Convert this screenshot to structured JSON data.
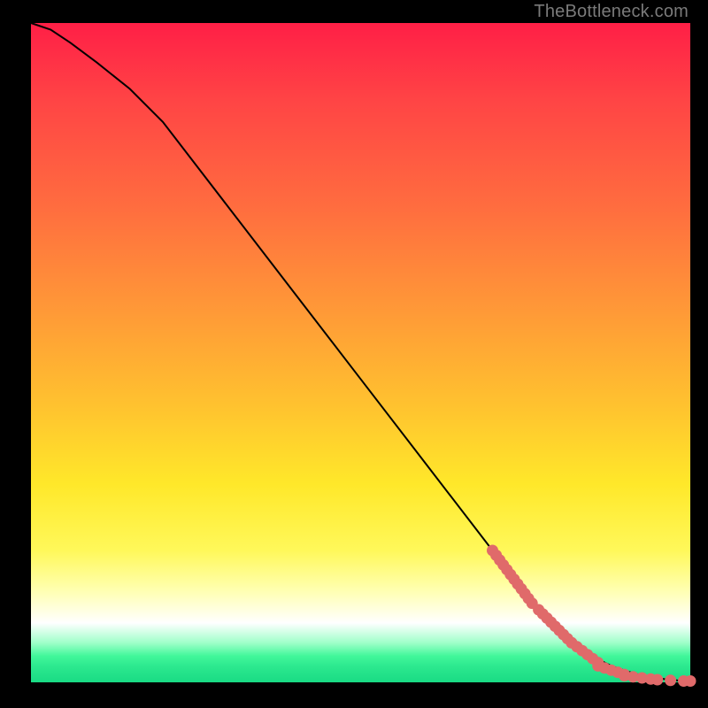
{
  "attribution": "TheBottleneck.com",
  "chart_data": {
    "type": "line",
    "title": "",
    "xlabel": "",
    "ylabel": "",
    "xlim": [
      0,
      100
    ],
    "ylim": [
      0,
      100
    ],
    "series": [
      {
        "name": "curve",
        "x": [
          0,
          3,
          6,
          10,
          15,
          20,
          30,
          40,
          50,
          60,
          70,
          78,
          82,
          85,
          88,
          90,
          92,
          94,
          96,
          98,
          100
        ],
        "y": [
          100,
          99,
          97,
          94,
          90,
          85,
          72,
          59,
          46,
          33,
          20,
          10,
          6,
          4,
          2.5,
          1.8,
          1.2,
          0.8,
          0.5,
          0.3,
          0.2
        ]
      }
    ],
    "markers": [
      {
        "x_range": [
          70,
          76
        ],
        "count": 12,
        "y_from": 20,
        "y_to": 12
      },
      {
        "x_range": [
          77,
          82
        ],
        "count": 9,
        "y_from": 11,
        "y_to": 6
      },
      {
        "x_range": [
          82,
          86
        ],
        "count": 6,
        "y_from": 6,
        "y_to": 3
      },
      {
        "x_range": [
          86,
          90
        ],
        "count": 5,
        "y_from": 2.5,
        "y_to": 1.2
      },
      {
        "x_range": [
          90,
          94
        ],
        "count": 4,
        "y_from": 1.0,
        "y_to": 0.5
      },
      {
        "x_range": [
          95,
          97
        ],
        "count": 2,
        "y_from": 0.4,
        "y_to": 0.3
      },
      {
        "x_range": [
          99,
          100
        ],
        "count": 2,
        "y_from": 0.2,
        "y_to": 0.2
      }
    ],
    "marker_color": "#e06a6a",
    "curve_color": "#000000"
  }
}
